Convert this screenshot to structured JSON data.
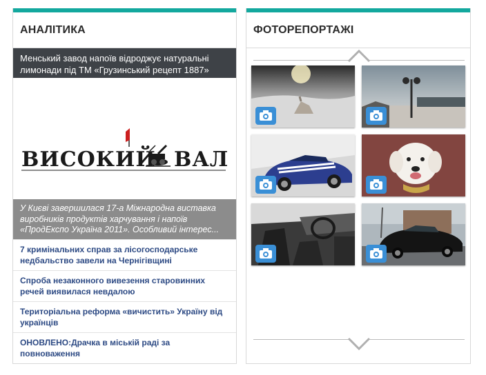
{
  "analytics": {
    "title": "АНАЛІТИКА",
    "lead_caption": "Менський завод напоїв відроджує натуральні лимонади під ТМ «Грузинський рецепт 1887»",
    "logo_text_left": "ВИСОКИЙ",
    "logo_text_right": "ВАЛ",
    "overlay_caption": "У Києві завершилася 17-а Міжнародна виставка виробників продуктів харчування і напоїв «ПродЕкспо Україна 2011». Особливий інтерес...",
    "news": [
      "7 кримінальних справ за лісогосподарське недбальство завели на Чернігівщині",
      "Спроба незаконного вивезення старовинних речей виявилася невдалою",
      "Територіальна реформа «вичистить» Україну від українців",
      "ОНОВЛЕНО:Драчка в міській раді за повноваження"
    ]
  },
  "photo_reports": {
    "title": "ФОТОРЕПОРТАЖІ",
    "thumbnails": [
      {
        "subject": "winter-field-horse-photo"
      },
      {
        "subject": "winter-park-lamp-photo"
      },
      {
        "subject": "blue-car-photo"
      },
      {
        "subject": "white-dog-photo"
      },
      {
        "subject": "car-interior-photo"
      },
      {
        "subject": "black-car-photo"
      }
    ]
  },
  "colors": {
    "accent": "#13a89e",
    "link": "#2d4a84",
    "caption_dark": "#3e4247",
    "caption_gray": "#8c8c8c",
    "camera_badge": "#3a8fd6"
  }
}
